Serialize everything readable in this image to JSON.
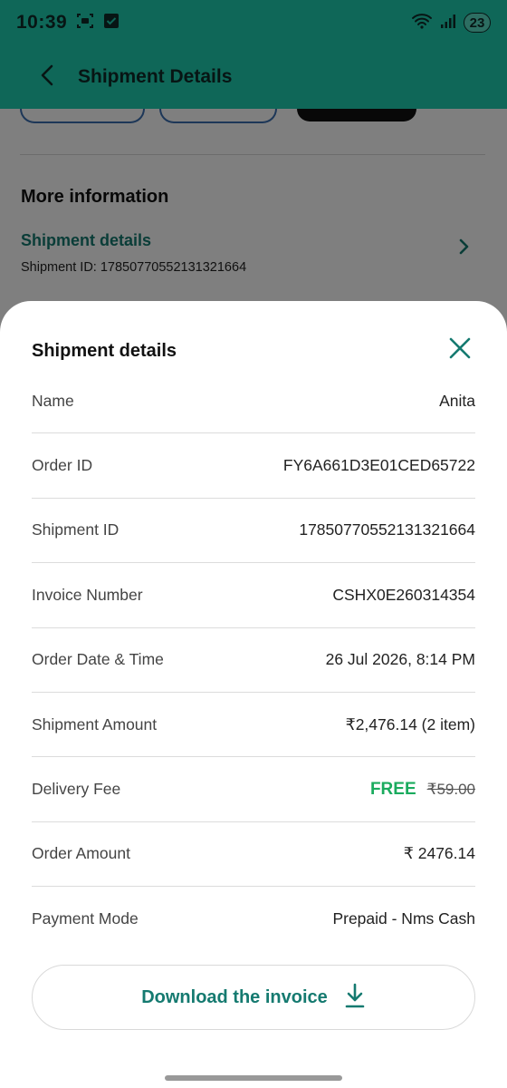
{
  "status_bar": {
    "time": "10:39",
    "battery": "23"
  },
  "app_bar": {
    "title": "Shipment Details"
  },
  "background": {
    "section_title": "More information",
    "shipment_link": "Shipment details",
    "shipment_id_line": "Shipment ID: 17850770552131321664"
  },
  "sheet": {
    "title": "Shipment details",
    "rows": [
      {
        "label": "Name",
        "value": "Anita"
      },
      {
        "label": "Order ID",
        "value": "FY6A661D3E01CED65722"
      },
      {
        "label": "Shipment ID",
        "value": "17850770552131321664"
      },
      {
        "label": "Invoice Number",
        "value": "CSHX0E260314354"
      },
      {
        "label": "Order Date & Time",
        "value": "26 Jul 2026, 8:14 PM"
      },
      {
        "label": "Shipment Amount",
        "value": "₹2,476.14 (2 item)"
      },
      {
        "label": "Delivery Fee",
        "free_text": "FREE",
        "original_fee": "₹59.00"
      },
      {
        "label": "Order Amount",
        "value": "₹ 2476.14"
      },
      {
        "label": "Payment Mode",
        "value": "Prepaid - Nms Cash"
      }
    ],
    "download_label": "Download the invoice"
  },
  "colors": {
    "header_bg": "#1fcfb1",
    "accent_teal": "#157a70",
    "free_green": "#1aab5e"
  },
  "icons": {
    "back": "arrow-left-icon",
    "close": "close-icon",
    "download": "download-icon",
    "chevron": "chevron-right-icon"
  }
}
